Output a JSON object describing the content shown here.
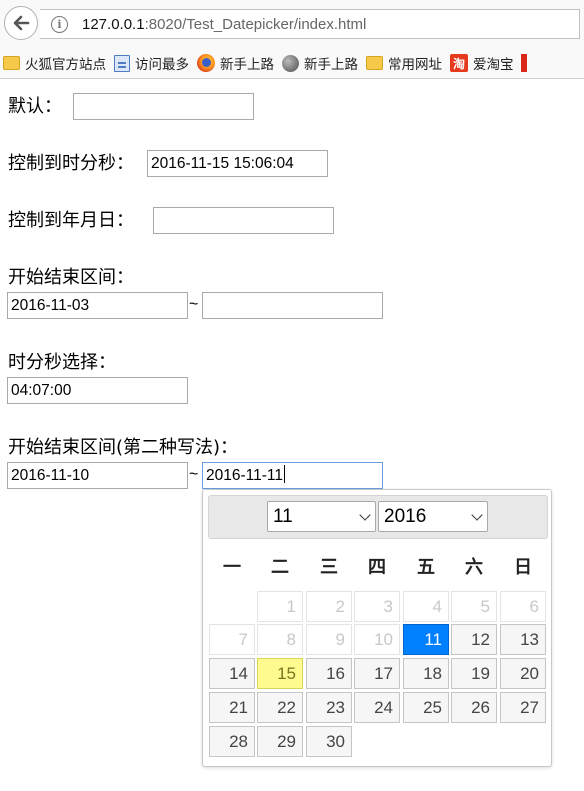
{
  "browser": {
    "url_host": "127.0.0.1",
    "url_rest": ":8020/Test_Datepicker/index.html",
    "bookmarks": [
      {
        "label": "火狐官方站点",
        "icon": "folder-icon"
      },
      {
        "label": "访问最多",
        "icon": "page-icon"
      },
      {
        "label": "新手上路",
        "icon": "firefox-icon"
      },
      {
        "label": "新手上路",
        "icon": "globe-icon"
      },
      {
        "label": "常用网址",
        "icon": "folder-icon"
      },
      {
        "label": "爱淘宝",
        "icon": "taobao-icon"
      }
    ],
    "taobao_glyph": "淘"
  },
  "form": {
    "default": {
      "label": "默认：",
      "value": ""
    },
    "datetime": {
      "label": "控制到时分秒：",
      "value": "2016-11-15 15:06:04"
    },
    "date": {
      "label": "控制到年月日：",
      "value": ""
    },
    "range1": {
      "label": "开始结束区间：",
      "start": "2016-11-03",
      "separator": "~",
      "end": ""
    },
    "time": {
      "label": "时分秒选择：",
      "value": "04:07:00"
    },
    "range2": {
      "label": "开始结束区间(第二种写法)：",
      "start": "2016-11-10",
      "separator": "~",
      "end": "2016-11-11"
    }
  },
  "datepicker": {
    "month": "11",
    "year": "2016",
    "weekdays": [
      "一",
      "二",
      "三",
      "四",
      "五",
      "六",
      "日"
    ],
    "weeks": [
      [
        null,
        {
          "d": "1",
          "s": "disabled"
        },
        {
          "d": "2",
          "s": "disabled"
        },
        {
          "d": "3",
          "s": "disabled"
        },
        {
          "d": "4",
          "s": "disabled"
        },
        {
          "d": "5",
          "s": "disabled"
        },
        {
          "d": "6",
          "s": "disabled"
        }
      ],
      [
        {
          "d": "7",
          "s": "disabled"
        },
        {
          "d": "8",
          "s": "disabled"
        },
        {
          "d": "9",
          "s": "disabled"
        },
        {
          "d": "10",
          "s": "disabled"
        },
        {
          "d": "11",
          "s": "selected"
        },
        {
          "d": "12",
          "s": "default"
        },
        {
          "d": "13",
          "s": "default"
        }
      ],
      [
        {
          "d": "14",
          "s": "default"
        },
        {
          "d": "15",
          "s": "today"
        },
        {
          "d": "16",
          "s": "default"
        },
        {
          "d": "17",
          "s": "default"
        },
        {
          "d": "18",
          "s": "default"
        },
        {
          "d": "19",
          "s": "default"
        },
        {
          "d": "20",
          "s": "default"
        }
      ],
      [
        {
          "d": "21",
          "s": "default"
        },
        {
          "d": "22",
          "s": "default"
        },
        {
          "d": "23",
          "s": "default"
        },
        {
          "d": "24",
          "s": "default"
        },
        {
          "d": "25",
          "s": "default"
        },
        {
          "d": "26",
          "s": "default"
        },
        {
          "d": "27",
          "s": "default"
        }
      ],
      [
        {
          "d": "28",
          "s": "default"
        },
        {
          "d": "29",
          "s": "default"
        },
        {
          "d": "30",
          "s": "default"
        },
        null,
        null,
        null,
        null
      ]
    ]
  },
  "colors": {
    "selected_day": "#007fff",
    "today_day": "#fffa90",
    "header_bg": "#e8e8e8"
  }
}
